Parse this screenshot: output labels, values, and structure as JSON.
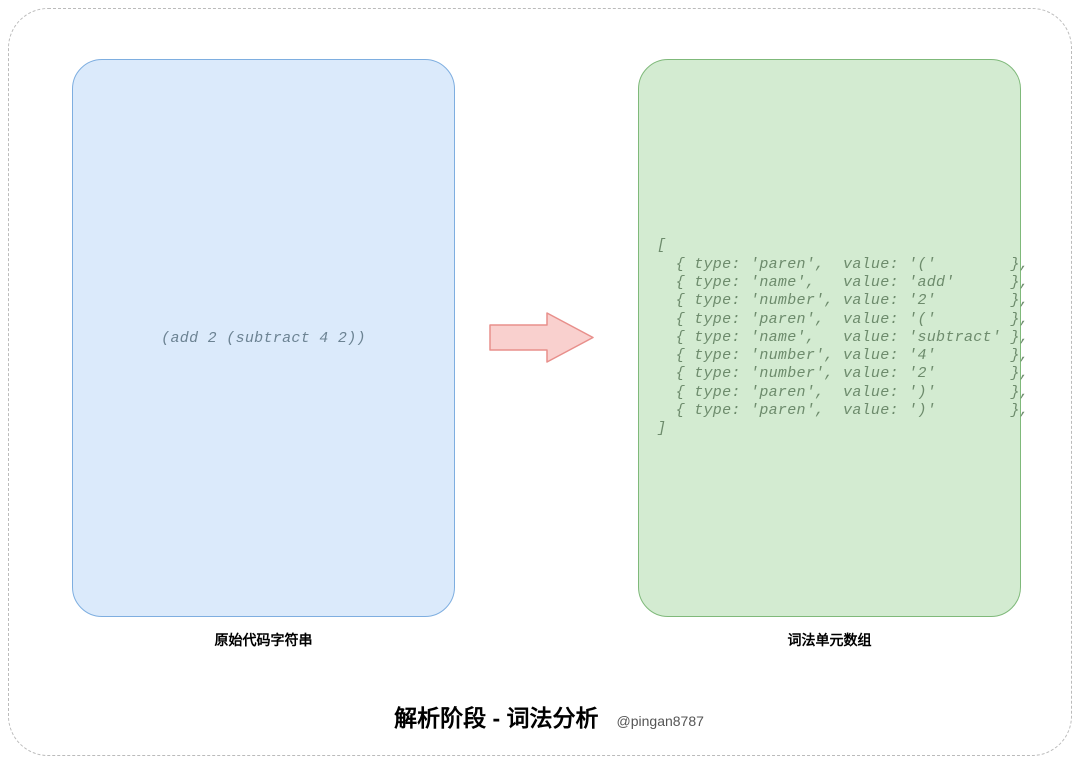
{
  "left_panel": {
    "code": "(add 2 (subtract 4 2))",
    "caption": "原始代码字符串"
  },
  "right_panel": {
    "caption": "词法单元数组",
    "tokens": [
      {
        "type": "paren",
        "value": "("
      },
      {
        "type": "name",
        "value": "add"
      },
      {
        "type": "number",
        "value": "2"
      },
      {
        "type": "paren",
        "value": "("
      },
      {
        "type": "name",
        "value": "subtract"
      },
      {
        "type": "number",
        "value": "4"
      },
      {
        "type": "number",
        "value": "2"
      },
      {
        "type": "paren",
        "value": ")"
      },
      {
        "type": "paren",
        "value": ")"
      }
    ]
  },
  "title": {
    "main": "解析阶段 - 词法分析",
    "handle": "@pingan8787"
  },
  "arrow": {
    "name": "arrow-right-icon",
    "fill": "#f9d0ce",
    "stroke": "#e88f8b"
  }
}
